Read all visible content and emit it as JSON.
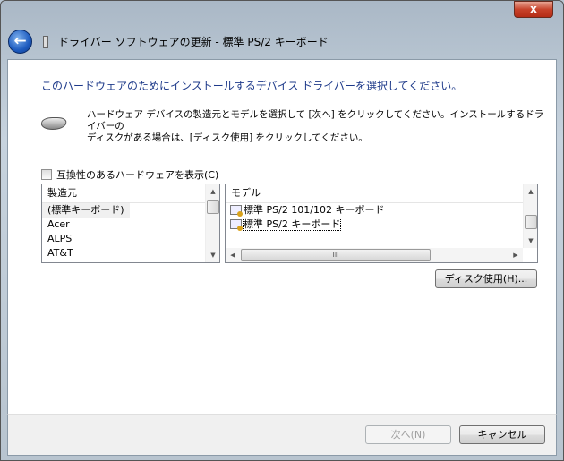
{
  "window": {
    "title": "ドライバー ソフトウェアの更新 - 標準 PS/2 キーボード",
    "close_label": "x",
    "back_label": "←"
  },
  "heading": "このハードウェアのためにインストールするデバイス ドライバーを選択してください。",
  "description": [
    "ハードウェア デバイスの製造元とモデルを選択して [次へ] をクリックしてください。インストールするドライバーの",
    "ディスクがある場合は、[ディスク使用] をクリックしてください。"
  ],
  "compatible_checkbox": {
    "label": "互換性のあるハードウェアを表示(C)",
    "checked": false
  },
  "manufacturers": {
    "header": "製造元",
    "items": [
      "(標準キーボード)",
      "Acer",
      "ALPS",
      "AT&T"
    ],
    "selected": 0
  },
  "models": {
    "header": "モデル",
    "items": [
      "標準 PS/2 101/102 キーボード",
      "標準 PS/2 キーボード"
    ],
    "selected": 1
  },
  "buttons": {
    "have_disk": "ディスク使用(H)...",
    "next": "次へ(N)",
    "cancel": "キャンセル"
  },
  "scroll_glyphs": {
    "up": "▲",
    "down": "▼",
    "left": "◀",
    "right": "▶",
    "grip": "III"
  }
}
